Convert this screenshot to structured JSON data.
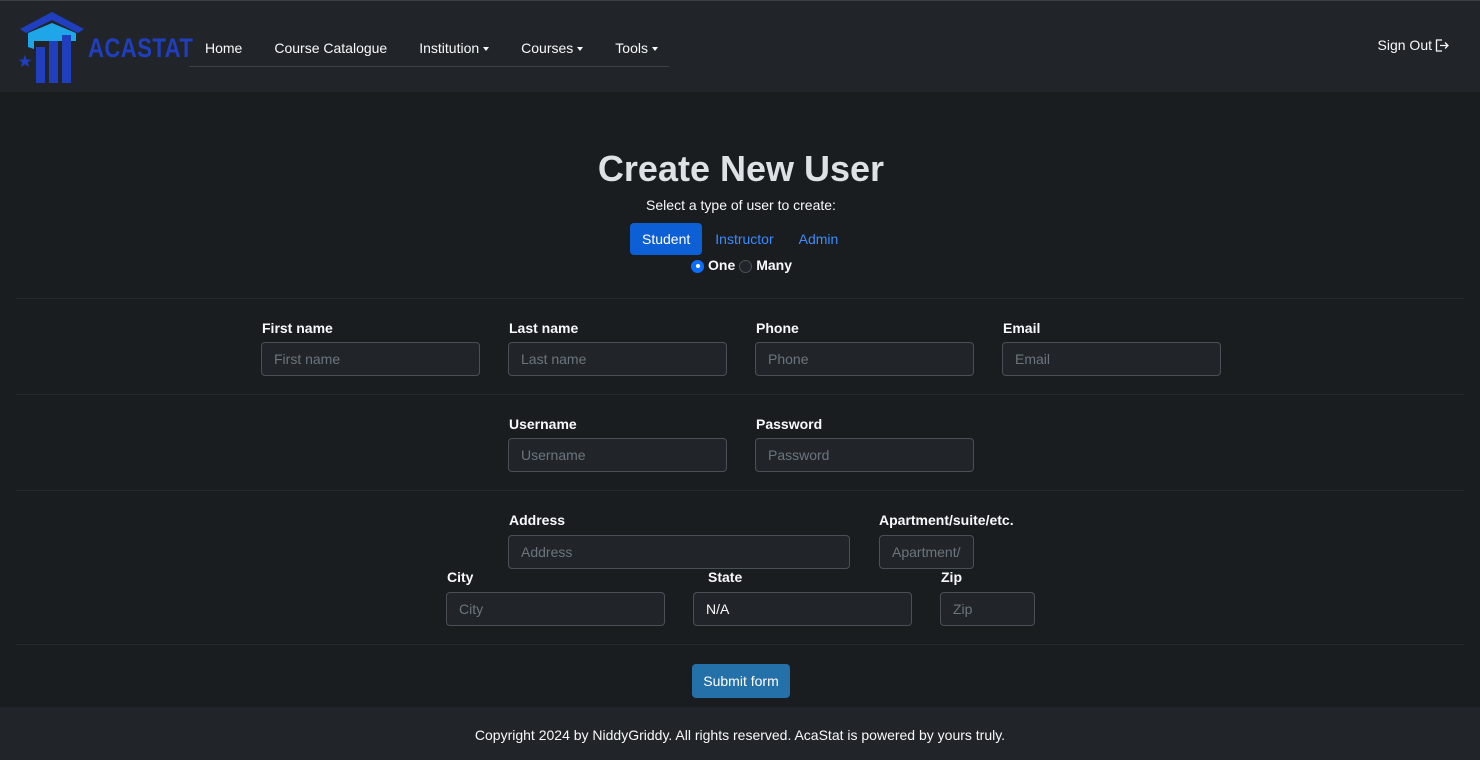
{
  "brand": {
    "name": "ACASTAT"
  },
  "nav": {
    "items": [
      {
        "label": "Home",
        "dropdown": false
      },
      {
        "label": "Course Catalogue",
        "dropdown": false
      },
      {
        "label": "Institution",
        "dropdown": true
      },
      {
        "label": "Courses",
        "dropdown": true
      },
      {
        "label": "Tools",
        "dropdown": true
      }
    ],
    "signout_label": "Sign Out"
  },
  "page": {
    "title": "Create New User",
    "subtitle": "Select a type of user to create:",
    "user_types": [
      {
        "label": "Student",
        "active": true
      },
      {
        "label": "Instructor",
        "active": false
      },
      {
        "label": "Admin",
        "active": false
      }
    ],
    "count_options": [
      {
        "label": "One",
        "selected": true
      },
      {
        "label": "Many",
        "selected": false
      }
    ]
  },
  "form": {
    "first_name": {
      "label": "First name",
      "placeholder": "First name",
      "value": ""
    },
    "last_name": {
      "label": "Last name",
      "placeholder": "Last name",
      "value": ""
    },
    "phone": {
      "label": "Phone",
      "placeholder": "Phone",
      "value": ""
    },
    "email": {
      "label": "Email",
      "placeholder": "Email",
      "value": ""
    },
    "username": {
      "label": "Username",
      "placeholder": "Username",
      "value": ""
    },
    "password": {
      "label": "Password",
      "placeholder": "Password",
      "value": ""
    },
    "address": {
      "label": "Address",
      "placeholder": "Address",
      "value": ""
    },
    "apartment": {
      "label": "Apartment/suite/etc.",
      "placeholder": "Apartment/suite/etc.",
      "value": ""
    },
    "city": {
      "label": "City",
      "placeholder": "City",
      "value": ""
    },
    "state": {
      "label": "State",
      "value": "N/A"
    },
    "zip": {
      "label": "Zip",
      "placeholder": "Zip",
      "value": ""
    },
    "submit_label": "Submit form"
  },
  "footer": {
    "text": "Copyright 2024 by NiddyGriddy. All rights reserved. AcaStat is powered by yours truly."
  },
  "colors": {
    "background": "#1a1d20",
    "navbar": "#212529",
    "primary": "#0d5fd6",
    "link": "#3d8bfd",
    "submit": "#2470a8",
    "logo_blue": "#1f3fbf",
    "logo_cyan": "#1ea6e8"
  }
}
